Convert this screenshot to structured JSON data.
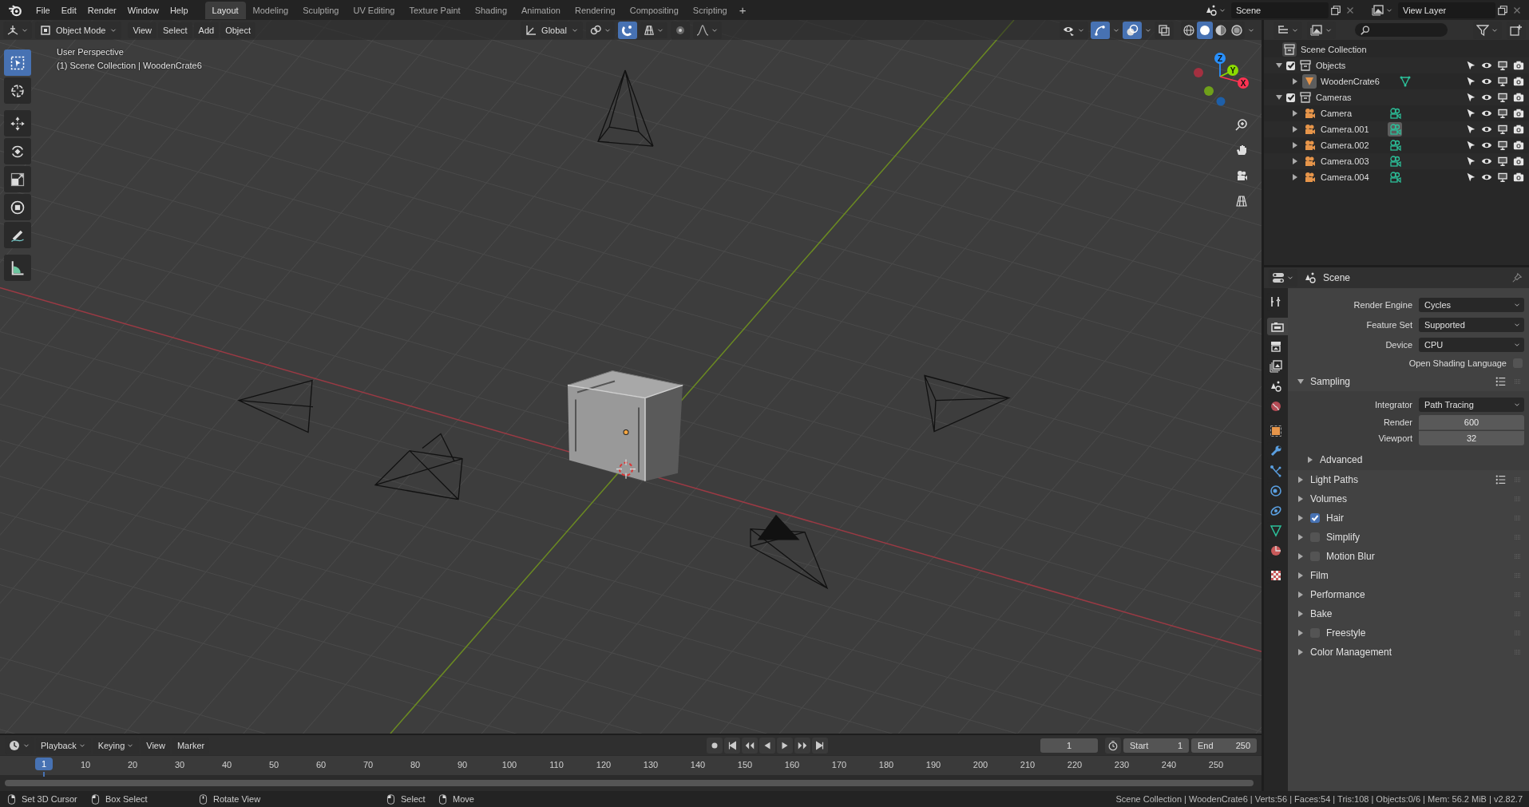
{
  "topbar": {
    "menus": [
      "File",
      "Edit",
      "Render",
      "Window",
      "Help"
    ],
    "workspaces": [
      {
        "label": "Layout",
        "selected": true
      },
      {
        "label": "Modeling",
        "selected": false
      },
      {
        "label": "Sculpting",
        "selected": false
      },
      {
        "label": "UV Editing",
        "selected": false
      },
      {
        "label": "Texture Paint",
        "selected": false
      },
      {
        "label": "Shading",
        "selected": false
      },
      {
        "label": "Animation",
        "selected": false
      },
      {
        "label": "Rendering",
        "selected": false
      },
      {
        "label": "Compositing",
        "selected": false
      },
      {
        "label": "Scripting",
        "selected": false
      }
    ],
    "add_workspace": "+",
    "scene": "Scene",
    "view_layer": "View Layer"
  },
  "viewport": {
    "mode": "Object Mode",
    "menus": [
      "View",
      "Select",
      "Add",
      "Object"
    ],
    "orientation": "Global",
    "toggles": [
      {
        "kind": "snap",
        "on": true
      },
      {
        "kind": "proportional",
        "on": false
      },
      {
        "kind": "gizmos",
        "on": true
      },
      {
        "kind": "overlays",
        "on": true
      },
      {
        "kind": "xray",
        "on": false
      }
    ],
    "shading": [
      {
        "kind": "wireframe",
        "selected": false
      },
      {
        "kind": "solid",
        "selected": true
      },
      {
        "kind": "material",
        "selected": false
      },
      {
        "kind": "rendered",
        "selected": false
      }
    ],
    "info": [
      "User Perspective",
      "(1) Scene Collection | WoodenCrate6"
    ],
    "tools": [
      {
        "kind": "select",
        "selected": true
      },
      {
        "kind": "cursor",
        "selected": false
      },
      {
        "kind": "move",
        "selected": false
      },
      {
        "kind": "rotate",
        "selected": false
      },
      {
        "kind": "scale",
        "selected": false
      },
      {
        "kind": "transform",
        "selected": false
      },
      {
        "kind": "annotate",
        "selected": false
      },
      {
        "kind": "measure",
        "selected": false
      }
    ],
    "axes": [
      {
        "label": "X",
        "color": "#ff3352"
      },
      {
        "label": "Y",
        "color": "#8bdc00"
      },
      {
        "label": "Z",
        "color": "#2890ff"
      }
    ]
  },
  "outliner": {
    "root": "Scene Collection",
    "items": [
      {
        "label": "Objects",
        "kind": "collection",
        "checked": true,
        "expanded": true,
        "children": [
          {
            "label": "WoodenCrate6",
            "kind": "mesh",
            "expanded": false,
            "object_highlighted": true,
            "data_highlighted": false
          }
        ]
      },
      {
        "label": "Cameras",
        "kind": "collection",
        "checked": true,
        "expanded": true,
        "children": [
          {
            "label": "Camera",
            "kind": "camera",
            "expanded": false,
            "object_highlighted": false,
            "data_highlighted": false
          },
          {
            "label": "Camera.001",
            "kind": "camera",
            "expanded": false,
            "object_highlighted": false,
            "data_highlighted": true
          },
          {
            "label": "Camera.002",
            "kind": "camera",
            "expanded": false,
            "object_highlighted": false,
            "data_highlighted": false
          },
          {
            "label": "Camera.003",
            "kind": "camera",
            "expanded": false,
            "object_highlighted": false,
            "data_highlighted": false
          },
          {
            "label": "Camera.004",
            "kind": "camera",
            "expanded": false,
            "object_highlighted": false,
            "data_highlighted": false
          }
        ]
      }
    ]
  },
  "properties": {
    "context": "Scene",
    "tabs": [
      {
        "kind": "tool",
        "selected": false
      },
      {
        "kind": "render",
        "selected": true
      },
      {
        "kind": "output",
        "selected": false
      },
      {
        "kind": "view_layer",
        "selected": false
      },
      {
        "kind": "scene",
        "selected": false
      },
      {
        "kind": "world",
        "selected": false
      },
      {
        "kind": "object",
        "selected": false
      },
      {
        "kind": "modifiers",
        "selected": false
      },
      {
        "kind": "particles",
        "selected": false
      },
      {
        "kind": "physics",
        "selected": false
      },
      {
        "kind": "constraints",
        "selected": false
      },
      {
        "kind": "data",
        "selected": false
      },
      {
        "kind": "material",
        "selected": false
      },
      {
        "kind": "texture",
        "selected": false
      }
    ],
    "fields": [
      {
        "label": "Render Engine",
        "value": "Cycles"
      },
      {
        "label": "Feature Set",
        "value": "Supported"
      },
      {
        "label": "Device",
        "value": "CPU"
      }
    ],
    "osl": {
      "label": "Open Shading Language",
      "checked": false
    },
    "sampling": {
      "label": "Sampling",
      "expanded": true,
      "integrator_label": "Integrator",
      "integrator": "Path Tracing",
      "samples": [
        {
          "label": "Render",
          "value": "600"
        },
        {
          "label": "Viewport",
          "value": "32"
        }
      ],
      "advanced": {
        "label": "Advanced",
        "expanded": false
      }
    },
    "panels": [
      {
        "label": "Light Paths",
        "kind": "presets",
        "expanded": false
      },
      {
        "label": "Volumes",
        "kind": "plain",
        "expanded": false
      },
      {
        "label": "Hair",
        "kind": "toggle",
        "checked": true,
        "expanded": false
      },
      {
        "label": "Simplify",
        "kind": "toggle",
        "checked": false,
        "expanded": false
      },
      {
        "label": "Motion Blur",
        "kind": "toggle",
        "checked": false,
        "expanded": false
      },
      {
        "label": "Film",
        "kind": "plain",
        "expanded": false
      },
      {
        "label": "Performance",
        "kind": "plain",
        "expanded": false
      },
      {
        "label": "Bake",
        "kind": "plain",
        "expanded": false
      },
      {
        "label": "Freestyle",
        "kind": "toggle",
        "checked": false,
        "expanded": false
      },
      {
        "label": "Color Management",
        "kind": "plain",
        "expanded": false
      }
    ]
  },
  "timeline": {
    "menus": [
      "Playback",
      "Keying",
      "View",
      "Marker"
    ],
    "current_frame": "1",
    "start_label": "Start",
    "start": "1",
    "end_label": "End",
    "end": "250",
    "playhead": "1",
    "ticks": [
      "10",
      "20",
      "30",
      "40",
      "50",
      "60",
      "70",
      "80",
      "90",
      "100",
      "110",
      "120",
      "130",
      "140",
      "150",
      "160",
      "170",
      "180",
      "190",
      "200",
      "210",
      "220",
      "230",
      "240",
      "250"
    ]
  },
  "status_bar": {
    "hints": [
      {
        "kind": "mouse_right",
        "label": "Set 3D Cursor"
      },
      {
        "kind": "mouse_left",
        "label": "Box Select"
      },
      {
        "kind": "mouse_middle",
        "label": "Rotate View"
      },
      {
        "kind": "mouse_left",
        "label": "Select"
      },
      {
        "kind": "mouse_right",
        "label": "Move"
      }
    ],
    "stats": "Scene Collection | WoodenCrate6 | Verts:56 | Faces:54 | Tris:108 | Objects:0/6 | Mem: 56.2 MiB | v2.82.7"
  }
}
